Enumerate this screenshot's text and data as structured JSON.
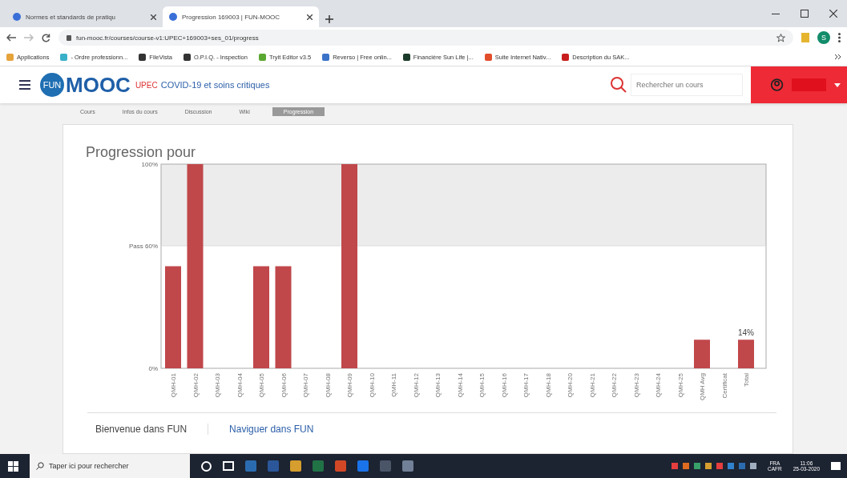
{
  "browser": {
    "tabs": [
      {
        "title": "Normes et standards de pratiqu",
        "selected": false
      },
      {
        "title": "Progression 169003 | FUN-MOOC",
        "selected": true
      }
    ],
    "url": "fun-mooc.fr/courses/course-v1:UPEC+169003+ses_01/progress",
    "profile_initial": "S",
    "bookmarks": [
      "Applications",
      "- Ordre professionn...",
      "FileVista",
      "O.P.I.Q. - Inspection",
      "Tryit Editor v3.5",
      "Reverso | Free onlin...",
      "Financière Sun Life |...",
      "Suite Internet Nativ...",
      "Description du SAK..."
    ]
  },
  "site": {
    "logo_badge": "FUN",
    "logo_text": "MOOC",
    "course_org": "UPEC",
    "course_name": "COVID-19 et soins critiques",
    "search_placeholder": "Rechercher un cours",
    "nav": [
      {
        "label": "Cours",
        "selected": false
      },
      {
        "label": "Infos du cours",
        "selected": false
      },
      {
        "label": "Discussion",
        "selected": false
      },
      {
        "label": "Wiki",
        "selected": false
      },
      {
        "label": "Progression",
        "selected": true
      }
    ]
  },
  "progress": {
    "title": "Progression pour",
    "chart_data": {
      "type": "bar",
      "categories": [
        "QMH-01",
        "QMH-02",
        "QMH-03",
        "QMH-04",
        "QMH-05",
        "QMH-06",
        "QMH-07",
        "QMH-08",
        "QMH-09",
        "QMH-10",
        "QMH-11",
        "QMH-12",
        "QMH-13",
        "QMH-14",
        "QMH-15",
        "QMH-16",
        "QMH-17",
        "QMH-18",
        "QMH-20",
        "QMH-21",
        "QMH-22",
        "QMH-23",
        "QMH-24",
        "QMH-25",
        "QMH Avg",
        "Certificat",
        "Total"
      ],
      "series": [
        {
          "color": "#c0474a",
          "values": [
            0.5,
            1,
            0,
            0,
            0.5,
            0.5,
            0,
            0,
            1,
            0,
            0,
            0,
            0,
            0,
            0,
            0,
            0,
            0,
            0,
            0,
            0,
            0,
            0,
            0,
            0.14,
            0,
            0.14
          ]
        }
      ],
      "ylim": [
        0,
        1
      ],
      "yticks": [
        {
          "value": 0,
          "label": "0%"
        },
        {
          "value": 0.6,
          "label": "Pass 60%"
        },
        {
          "value": 1,
          "label": "100%"
        }
      ],
      "value_labels": [
        null,
        null,
        null,
        null,
        null,
        null,
        null,
        null,
        null,
        null,
        null,
        null,
        null,
        null,
        null,
        null,
        null,
        null,
        null,
        null,
        null,
        null,
        null,
        null,
        null,
        null,
        "14%"
      ]
    }
  },
  "footer_links": [
    "Bienvenue dans FUN",
    "Naviguer dans FUN"
  ],
  "taskbar": {
    "search_placeholder": "Taper ici pour rechercher",
    "language": "FRA",
    "layout": "CAFR",
    "time": "11:06",
    "date": "25-03-2020"
  }
}
